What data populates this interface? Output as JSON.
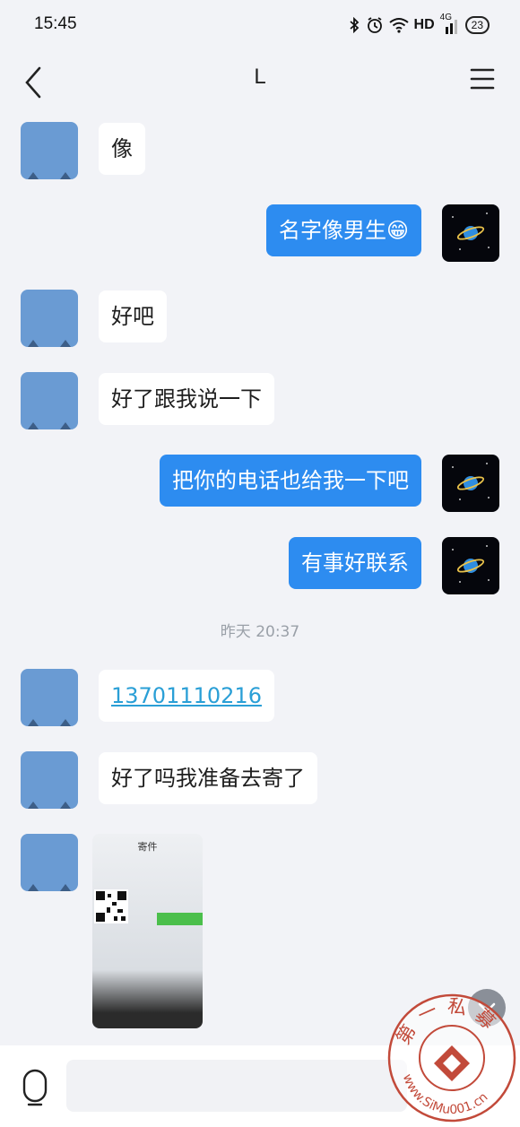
{
  "status_bar": {
    "time": "15:45",
    "network_label": "HD",
    "signal_label": "4G",
    "battery_level": "23",
    "icons": [
      "bluetooth-icon",
      "alarm-icon",
      "wifi-icon",
      "signal-icon",
      "battery-icon"
    ]
  },
  "header": {
    "title": "L",
    "back_icon": "chevron-left-icon",
    "menu_icon": "menu-icon"
  },
  "messages": [
    {
      "side": "in",
      "type": "text",
      "text": "像"
    },
    {
      "side": "out",
      "type": "text",
      "text": "名字像男生😁"
    },
    {
      "side": "in",
      "type": "text",
      "text": "好吧"
    },
    {
      "side": "in",
      "type": "text",
      "text": "好了跟我说一下"
    },
    {
      "side": "out",
      "type": "text",
      "text": "把你的电话也给我一下吧"
    },
    {
      "side": "out",
      "type": "text",
      "text": "有事好联系"
    },
    {
      "type": "timestamp",
      "text": "昨天 20:37"
    },
    {
      "side": "in",
      "type": "link",
      "text": "13701110216"
    },
    {
      "side": "in",
      "type": "text",
      "text": "好了吗我准备去寄了"
    },
    {
      "side": "in",
      "type": "image",
      "caption": "寄件"
    }
  ],
  "input_bar": {
    "placeholder": "",
    "voice_icon": "microphone-icon"
  },
  "watermark": {
    "top_text": "第一私募",
    "bottom_text": "www.SiMu001.cn"
  },
  "colors": {
    "background": "#f2f3f7",
    "outgoing_bubble": "#2d8cf0",
    "incoming_bubble": "#ffffff",
    "link": "#2a9fd6",
    "avatar_placeholder": "#6a9bd3",
    "watermark": "#c24a3a"
  }
}
